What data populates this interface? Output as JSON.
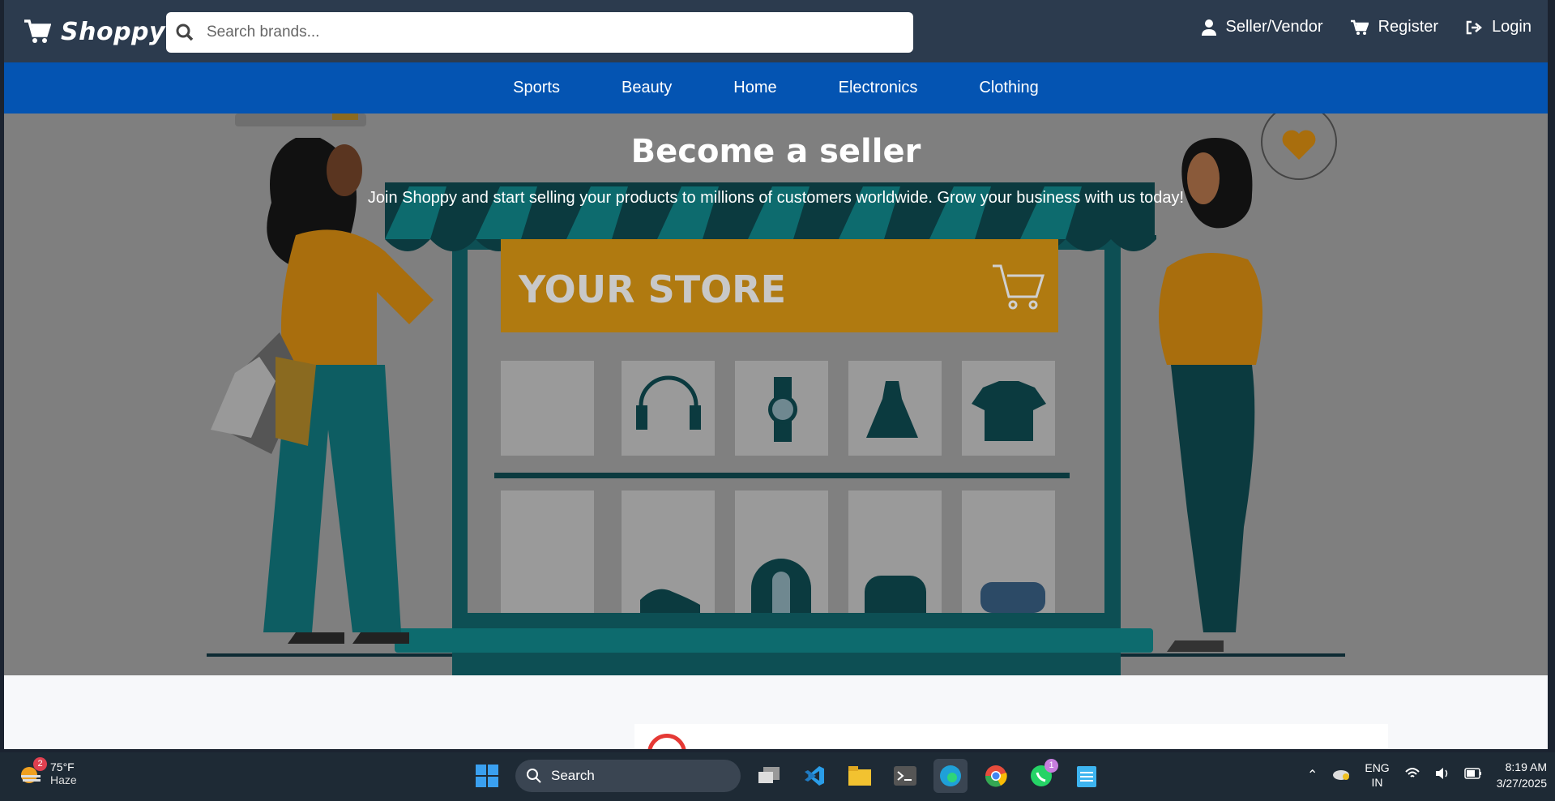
{
  "header": {
    "brand": "Shoppy",
    "search_placeholder": "Search brands...",
    "links": [
      {
        "label": "Seller/Vendor",
        "icon": "user-icon"
      },
      {
        "label": "Register",
        "icon": "cart-icon"
      },
      {
        "label": "Login",
        "icon": "login-icon"
      }
    ]
  },
  "categories": [
    "Sports",
    "Beauty",
    "Home",
    "Electronics",
    "Clothing"
  ],
  "hero": {
    "title": "Become a seller",
    "subtitle": "Join Shoppy and start selling your products to millions of customers worldwide. Grow your business with us today!",
    "store_sign": "YOUR STORE"
  },
  "taskbar": {
    "weather_temp": "75°F",
    "weather_desc": "Haze",
    "weather_badge": "2",
    "search_label": "Search",
    "whatsapp_badge": "1",
    "lang_line1": "ENG",
    "lang_line2": "IN",
    "time": "8:19 AM",
    "date": "3/27/2025"
  },
  "colors": {
    "header_bg": "#2c3b4e",
    "category_bar": "#0454b2",
    "hero_overlay": "#7f7f7f",
    "store_sign": "#b07a10",
    "teal": "#0d6b6e"
  }
}
